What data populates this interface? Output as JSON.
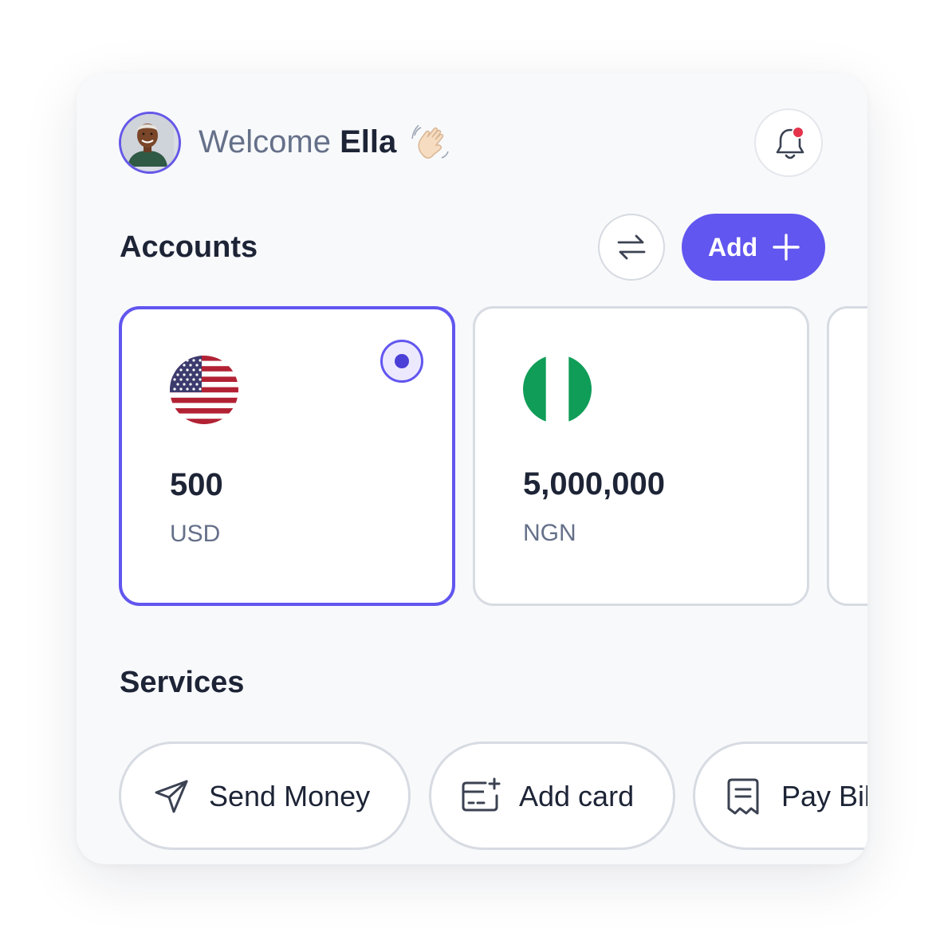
{
  "header": {
    "welcome_text": "Welcome",
    "user_name": "Ella",
    "notification_dot_color": "#e5334b"
  },
  "accounts": {
    "title": "Accounts",
    "add_label": "Add",
    "accent_color": "#6156ef",
    "cards": [
      {
        "flag": "us-flag-icon",
        "amount": "500",
        "currency": "USD",
        "selected": true
      },
      {
        "flag": "ng-flag-icon",
        "amount": "5,000,000",
        "currency": "NGN",
        "selected": false
      }
    ]
  },
  "services": {
    "title": "Services",
    "items": [
      {
        "icon": "send-icon",
        "label": "Send Money"
      },
      {
        "icon": "card-add-icon",
        "label": "Add card"
      },
      {
        "icon": "receipt-icon",
        "label": "Pay Bills"
      }
    ]
  }
}
